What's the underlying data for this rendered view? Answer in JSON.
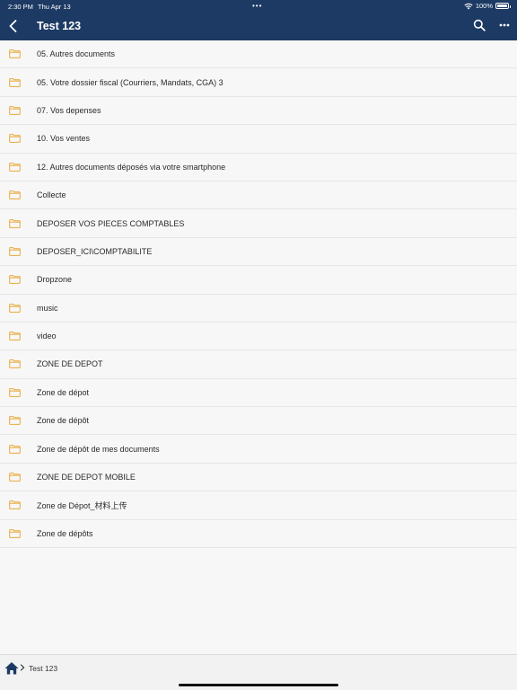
{
  "status_bar": {
    "time": "2:30 PM",
    "date": "Thu Apr 13",
    "battery": "100%"
  },
  "header": {
    "title": "Test 123"
  },
  "folders": [
    "05. Autres documents",
    "05. Votre dossier fiscal (Courriers, Mandats, CGA) 3",
    "07. Vos depenses",
    "10. Vos ventes",
    "12. Autres documents déposés via votre smartphone",
    "Collecte",
    "DEPOSER VOS PIECES COMPTABLES",
    "DEPOSER_ICI\\COMPTABILITE",
    "Dropzone",
    "music",
    "video",
    "ZONE DE DEPOT",
    "Zone de dépot",
    "Zone de dépôt",
    "Zone de dépôt de mes documents",
    "ZONE DE DEPOT MOBILE",
    "Zone de Dépot_材料上传",
    "Zone de dépôts"
  ],
  "breadcrumb": {
    "current": "Test 123"
  },
  "colors": {
    "header_bg": "#1c3a63",
    "folder_icon": "#e8a93a",
    "home_icon": "#1c3a63"
  },
  "icons": {
    "back": "chevron-left-icon",
    "search": "search-icon",
    "more": "more-horizontal-icon",
    "folder": "folder-icon",
    "home": "home-icon",
    "wifi": "wifi-icon",
    "battery": "battery-icon"
  }
}
